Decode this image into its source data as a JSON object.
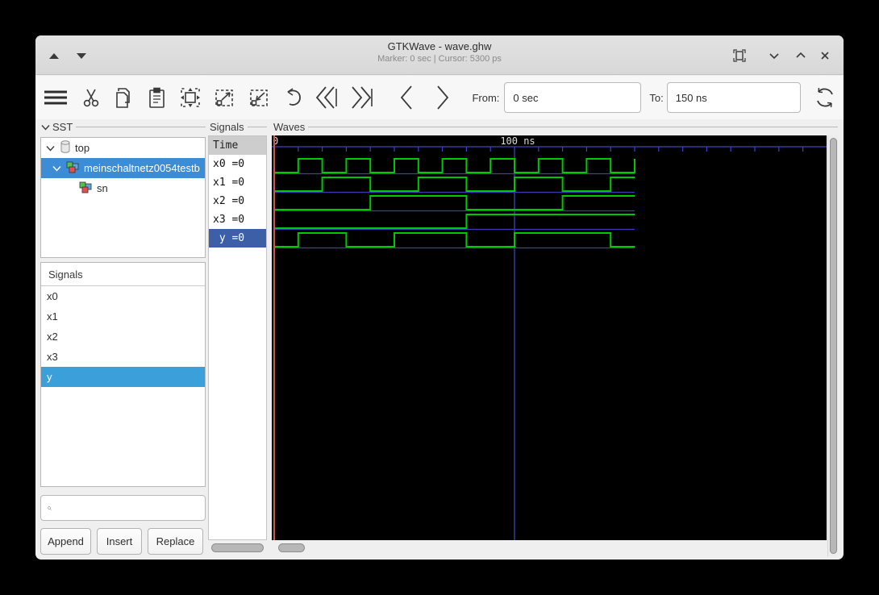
{
  "window": {
    "title": "GTKWave - wave.ghw",
    "statusline": "Marker: 0 sec  |  Cursor: 5300 ps"
  },
  "toolbar": {
    "icons": [
      "menu",
      "cut",
      "copy",
      "paste",
      "zoom-fit",
      "zoom-out",
      "zoom-in",
      "zoom-undo",
      "to-start",
      "to-end",
      "step-left",
      "step-right",
      "reload"
    ],
    "from_label": "From:",
    "from_value": "0 sec",
    "to_label": "To:",
    "to_value": "150 ns"
  },
  "sst": {
    "label": "SST",
    "tree": [
      {
        "label": "top"
      },
      {
        "label": "meinschaltnetz0054testb",
        "selected": true
      },
      {
        "label": "sn"
      }
    ]
  },
  "facs": {
    "label": "Signals",
    "items": [
      "x0",
      "x1",
      "x2",
      "x3",
      "y"
    ],
    "selected_index": 4
  },
  "search": {
    "placeholder": ""
  },
  "actions": {
    "append": "Append",
    "insert": "Insert",
    "replace": "Replace"
  },
  "names": {
    "label": "Signals",
    "time_header": "Time",
    "rows": [
      {
        "text": "x0 =0"
      },
      {
        "text": "x1 =0"
      },
      {
        "text": "x2 =0"
      },
      {
        "text": "x3 =0"
      },
      {
        "text": " y =0",
        "selected": true
      }
    ]
  },
  "waves": {
    "label": "Waves",
    "ruler": {
      "start_label": "0",
      "major_label": "100 ns",
      "t_start_ns": 0,
      "t_end_ns": 150,
      "tick_ns": 10,
      "major_ns": 100
    },
    "marker_ns": 0,
    "gridline_ns": 100,
    "signals": [
      {
        "name": "x0",
        "initial": 0,
        "transitions_ns": [
          10,
          20,
          30,
          40,
          50,
          60,
          70,
          80,
          90,
          100,
          110,
          120,
          130,
          140,
          150
        ]
      },
      {
        "name": "x1",
        "initial": 0,
        "transitions_ns": [
          20,
          40,
          60,
          80,
          100,
          120,
          140
        ]
      },
      {
        "name": "x2",
        "initial": 0,
        "transitions_ns": [
          40,
          80,
          120
        ]
      },
      {
        "name": "x3",
        "initial": 0,
        "transitions_ns": [
          80
        ]
      },
      {
        "name": "y",
        "initial": 0,
        "transitions_ns": [
          10,
          30,
          50,
          80,
          100,
          140
        ]
      }
    ],
    "colors": {
      "wave": "#00c800",
      "baseline": "#3c3cb4",
      "ruler": "#4040c8",
      "grid": "#4646cc",
      "marker": "#cc5555",
      "label_text": "#dddddd",
      "background": "#000000"
    }
  }
}
